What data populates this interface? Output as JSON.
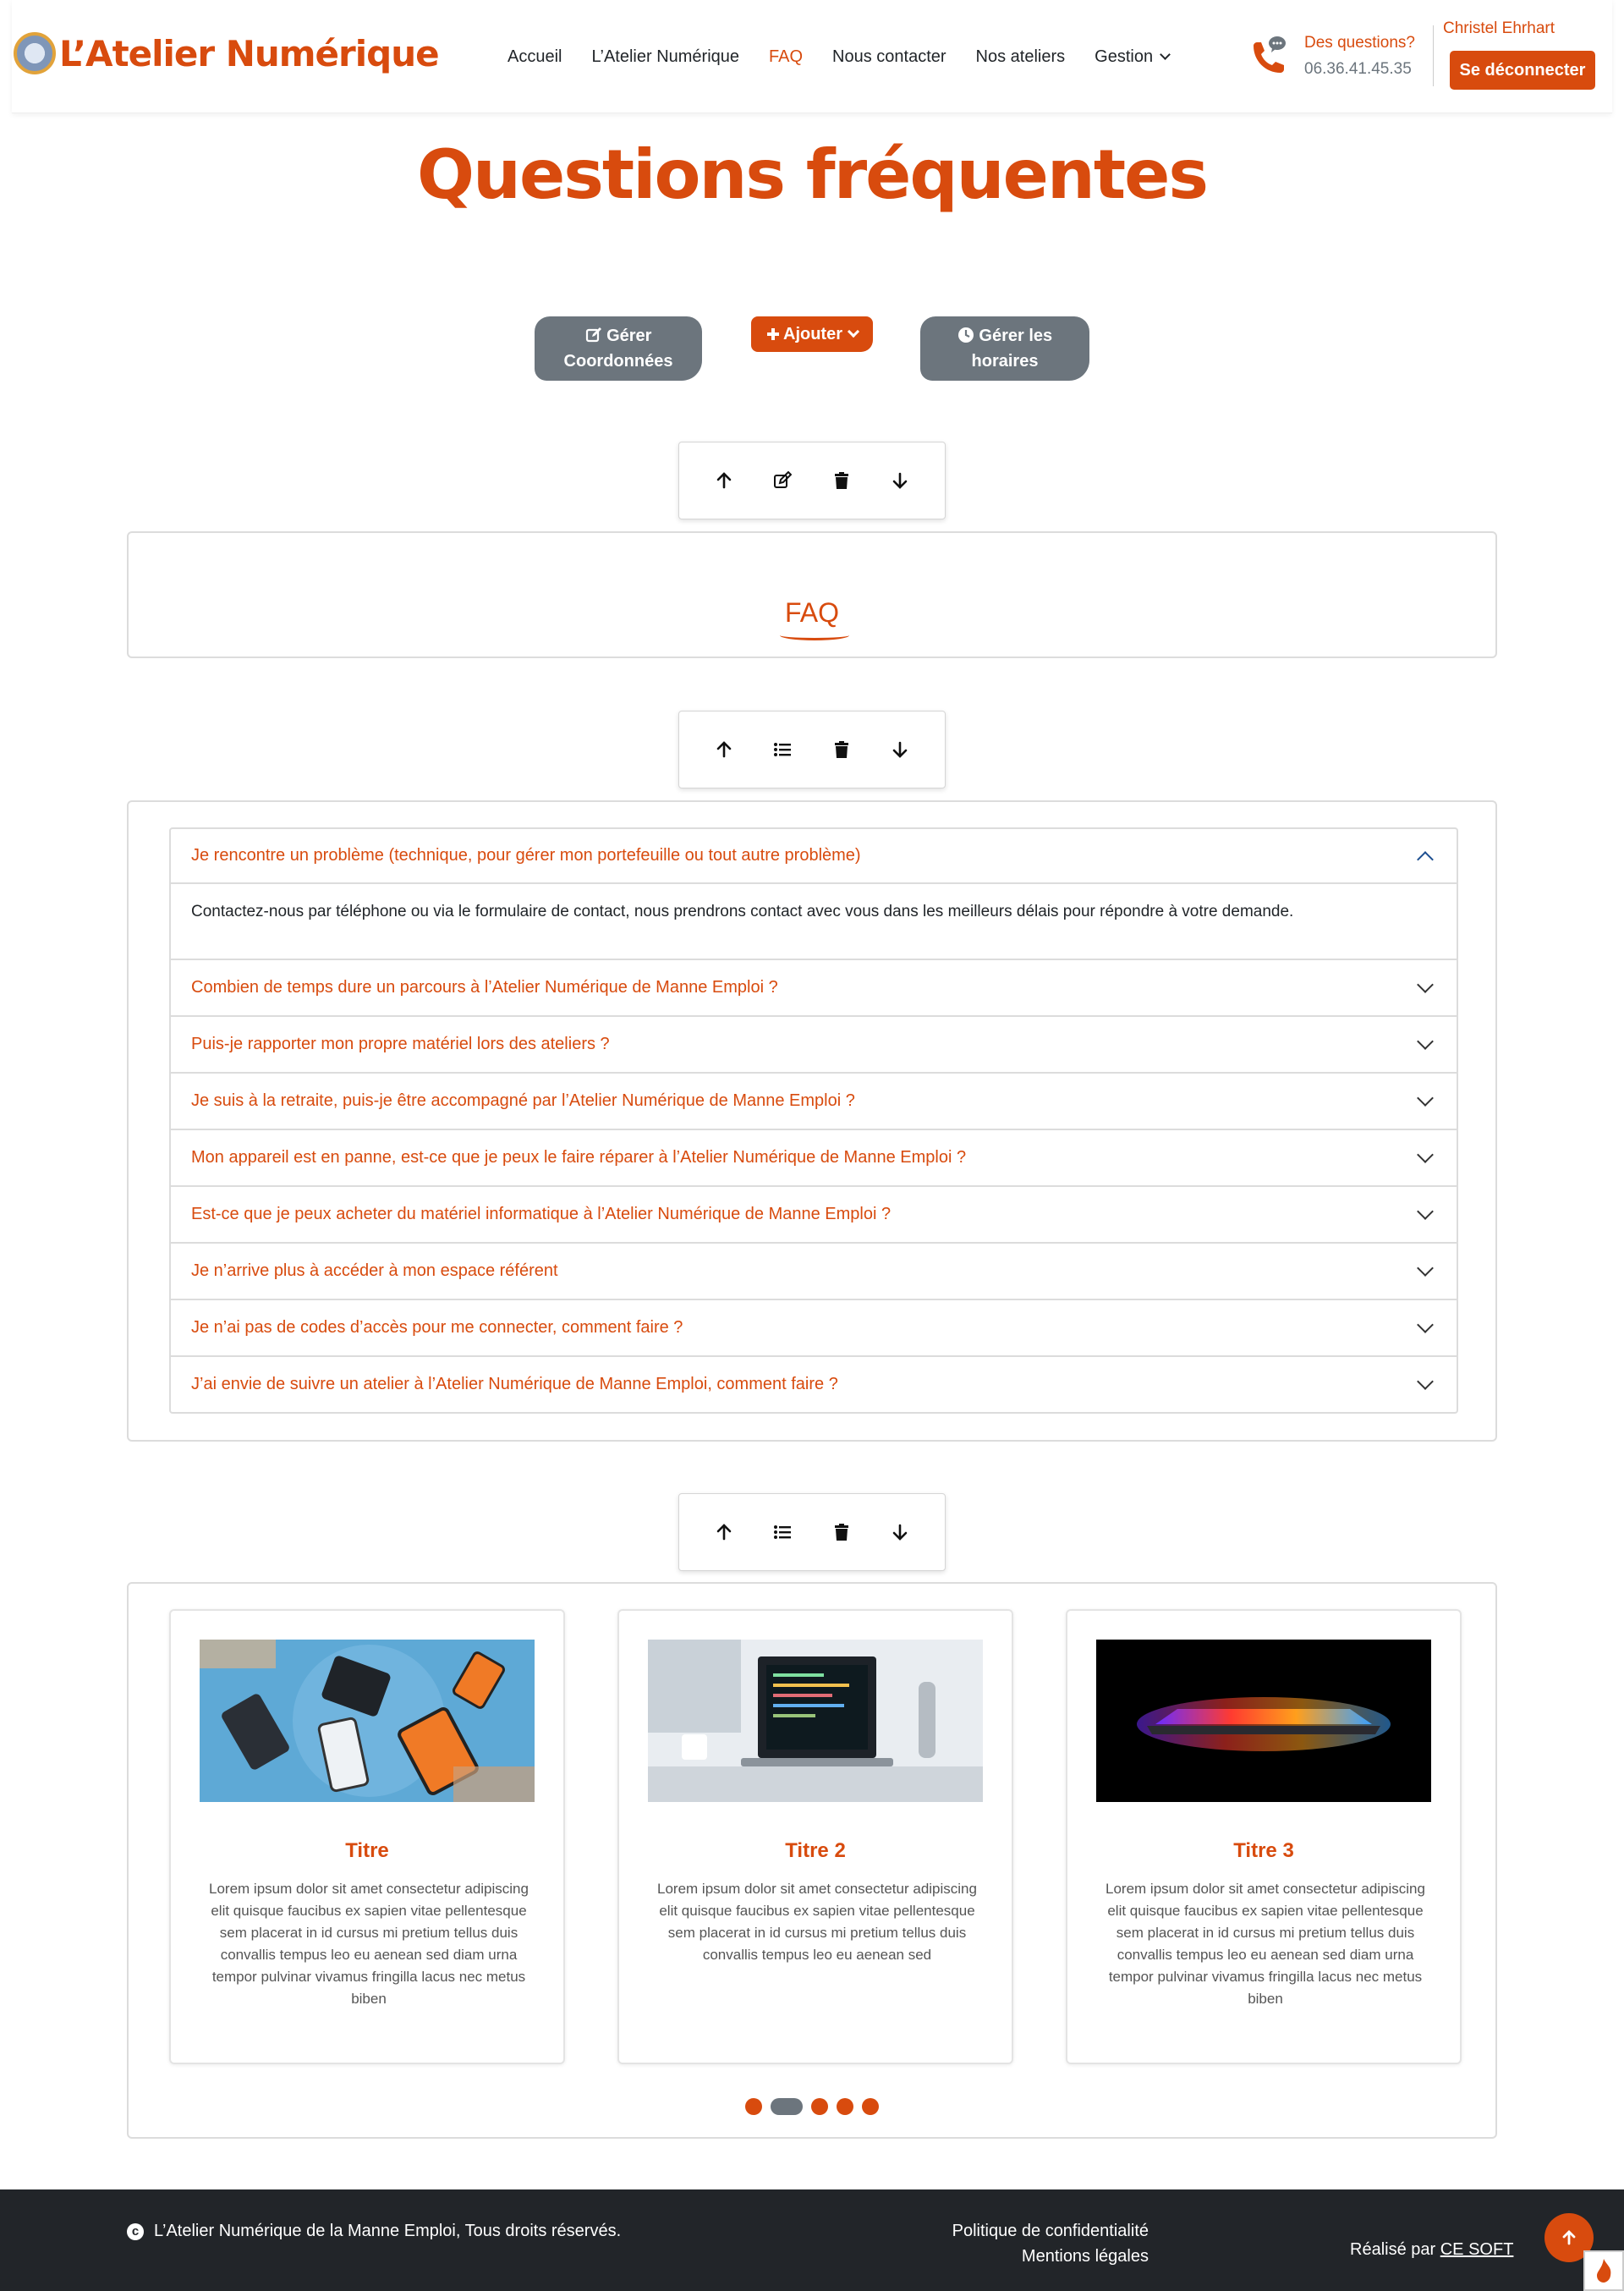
{
  "header": {
    "logo_text": "L’Atelier Numérique",
    "nav": [
      {
        "label": "Accueil"
      },
      {
        "label": "L’Atelier Numérique"
      },
      {
        "label": "FAQ"
      },
      {
        "label": "Nous contacter"
      },
      {
        "label": "Nos ateliers"
      },
      {
        "label": "Gestion"
      }
    ],
    "active_nav": "FAQ",
    "contact_question": "Des questions?",
    "contact_phone": "06.36.41.45.35",
    "user_name": "Christel Ehrhart",
    "logout_label": "Se déconnecter"
  },
  "page_title": "Questions fréquentes",
  "actions": {
    "manage_contact": [
      "Gérer",
      "Coordonnées"
    ],
    "add": "Ajouter",
    "manage_hours": [
      "Gérer les",
      "horaires"
    ]
  },
  "faq_block": {
    "heading": "FAQ"
  },
  "accordion": {
    "items": [
      {
        "question": "Je rencontre un problème (technique, pour gérer mon portefeuille ou tout autre problème)",
        "answer": "Contactez-nous par téléphone ou via le formulaire de contact, nous prendrons contact avec vous dans les meilleurs délais pour répondre à votre demande.",
        "open": true
      },
      {
        "question": "Combien de temps dure un parcours à l’Atelier Numérique de Manne Emploi ?"
      },
      {
        "question": "Puis-je rapporter mon propre matériel lors des ateliers ?"
      },
      {
        "question": "Je suis à la retraite, puis-je être accompagné par l’Atelier Numérique de Manne Emploi ?"
      },
      {
        "question": "Mon appareil est en panne, est-ce que je peux le faire réparer à l’Atelier Numérique de Manne Emploi ?"
      },
      {
        "question": "Est-ce que je peux acheter du matériel informatique à l’Atelier Numérique de Manne Emploi ?"
      },
      {
        "question": "Je n’arrive plus à accéder à mon espace référent"
      },
      {
        "question": "Je n’ai pas de codes d’accès pour me connecter, comment faire ?"
      },
      {
        "question": "J’ai envie de suivre un atelier à l’Atelier Numérique de Manne Emploi, comment faire ?"
      }
    ]
  },
  "cards": [
    {
      "title": "Titre",
      "text": "Lorem ipsum dolor sit amet consectetur adipiscing elit quisque faucibus ex sapien vitae pellentesque sem placerat in id cursus mi pretium tellus duis convallis tempus leo eu aenean sed diam urna tempor pulvinar vivamus fringilla lacus nec metus biben"
    },
    {
      "title": "Titre 2",
      "text": "Lorem ipsum dolor sit amet consectetur adipiscing elit quisque faucibus ex sapien vitae pellentesque sem placerat in id cursus mi pretium tellus duis convallis tempus leo eu aenean sed"
    },
    {
      "title": "Titre 3",
      "text": "Lorem ipsum dolor sit amet consectetur adipiscing elit quisque faucibus ex sapien vitae pellentesque sem placerat in id cursus mi pretium tellus duis convallis tempus leo eu aenean sed diam urna tempor pulvinar vivamus fringilla lacus nec metus biben"
    }
  ],
  "carousel": {
    "dot_count": 5,
    "active_dot": 1
  },
  "footer": {
    "copyright": "L’Atelier Numérique de la Manne Emploi, Tous droits réservés.",
    "privacy": "Politique de confidentialité",
    "legal": "Mentions légales",
    "credit_prefix": "Réalisé par",
    "credit_link": "CE SOFT"
  },
  "icons": {
    "move_up": "arrow-up-icon",
    "edit": "edit-icon",
    "delete": "trash-icon",
    "move_down": "arrow-down-icon",
    "list": "list-icon",
    "phone": "phone-icon",
    "clock": "clock-icon",
    "plus": "plus-icon",
    "copyright": "copyright-icon"
  },
  "colors": {
    "accent": "#d84b0e",
    "secondary": "#6c757d",
    "footer_bg": "#222529"
  }
}
